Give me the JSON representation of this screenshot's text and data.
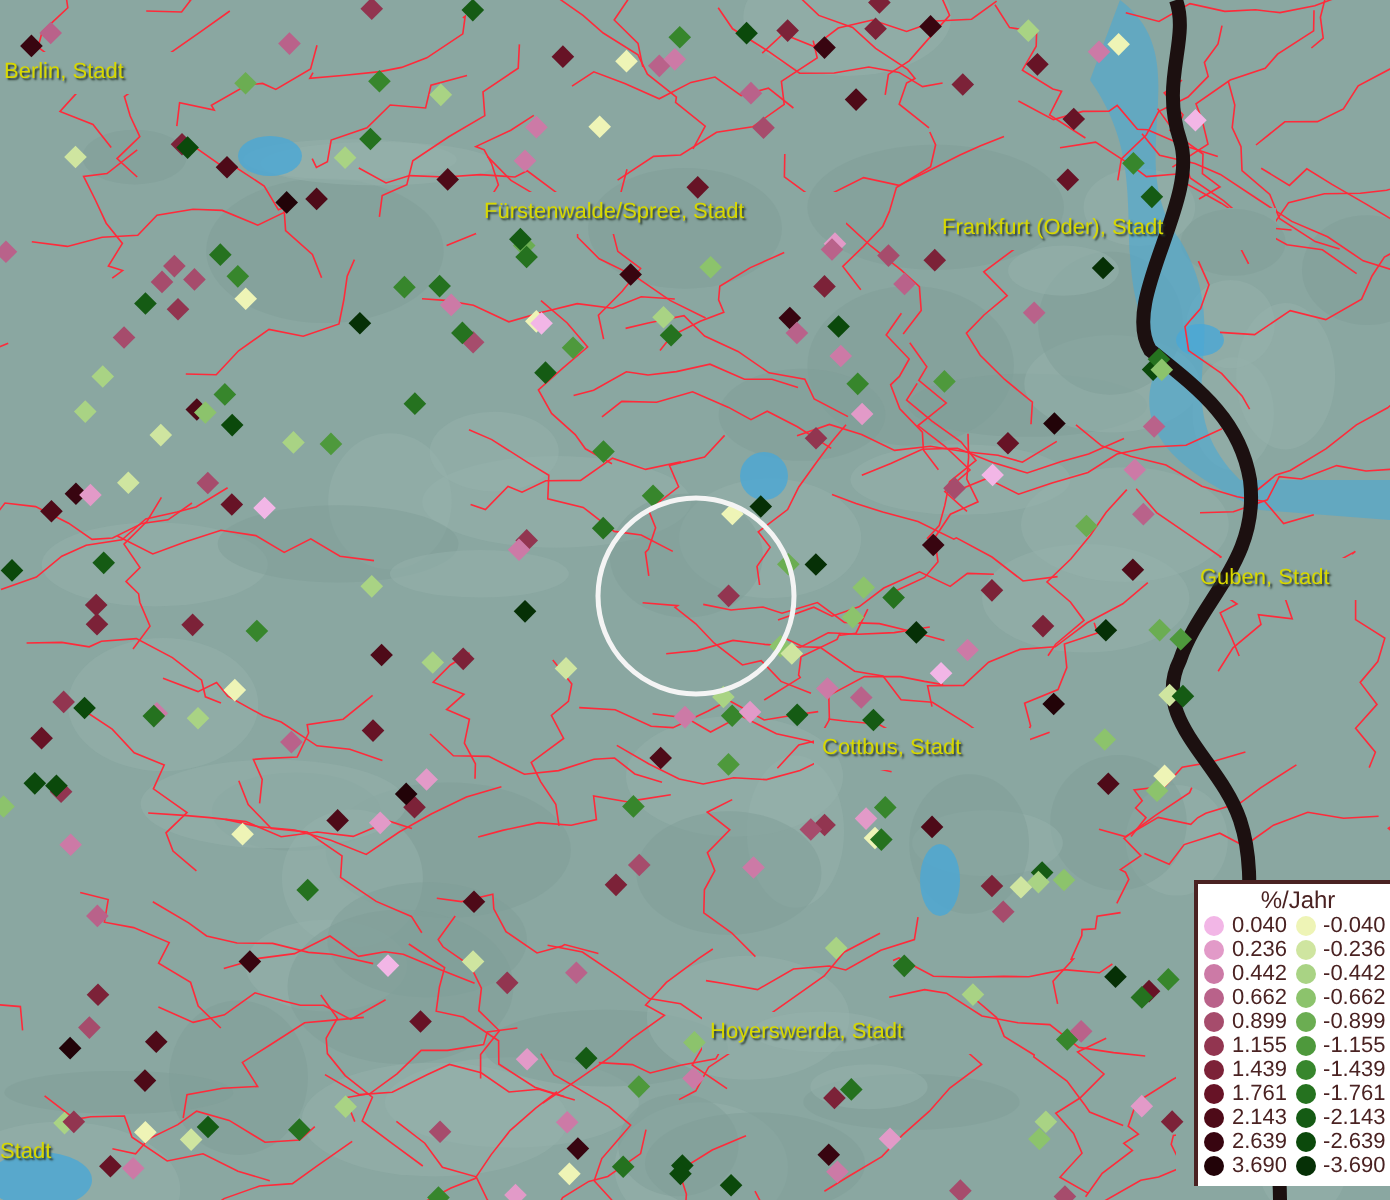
{
  "map": {
    "place_labels": [
      {
        "text": "Berlin, Stadt"
      },
      {
        "text": "Fürstenwalde/Spree, Stadt"
      },
      {
        "text": "Frankfurt (Oder), Stadt"
      },
      {
        "text": "Guben, Stadt"
      },
      {
        "text": "Cottbus, Stadt"
      },
      {
        "text": "Hoyerswerda, Stadt"
      },
      {
        "text": "Stadt"
      }
    ]
  },
  "legend": {
    "title": "%/Jahr",
    "columns": [
      [
        {
          "value": "0.040",
          "color": "#f2b6e6"
        },
        {
          "value": "0.236",
          "color": "#e29ac8"
        },
        {
          "value": "0.442",
          "color": "#cc7aa6"
        },
        {
          "value": "0.662",
          "color": "#b9628a"
        },
        {
          "value": "0.899",
          "color": "#a64c6c"
        },
        {
          "value": "1.155",
          "color": "#923550"
        },
        {
          "value": "1.439",
          "color": "#7c2238"
        },
        {
          "value": "1.761",
          "color": "#671326"
        },
        {
          "value": "2.143",
          "color": "#4e0a18"
        },
        {
          "value": "2.639",
          "color": "#380510"
        },
        {
          "value": "3.690",
          "color": "#220308"
        }
      ],
      [
        {
          "value": "-0.040",
          "color": "#eef4b6"
        },
        {
          "value": "-0.236",
          "color": "#cfe5a0"
        },
        {
          "value": "-0.442",
          "color": "#a9d384"
        },
        {
          "value": "-0.662",
          "color": "#8cc36c"
        },
        {
          "value": "-0.899",
          "color": "#6bad52"
        },
        {
          "value": "-1.155",
          "color": "#4e993c"
        },
        {
          "value": "-1.439",
          "color": "#37862c"
        },
        {
          "value": "-1.761",
          "color": "#25721f"
        },
        {
          "value": "-2.143",
          "color": "#155b14"
        },
        {
          "value": "-2.639",
          "color": "#0b490b"
        },
        {
          "value": "-3.690",
          "color": "#063006"
        }
      ]
    ]
  }
}
